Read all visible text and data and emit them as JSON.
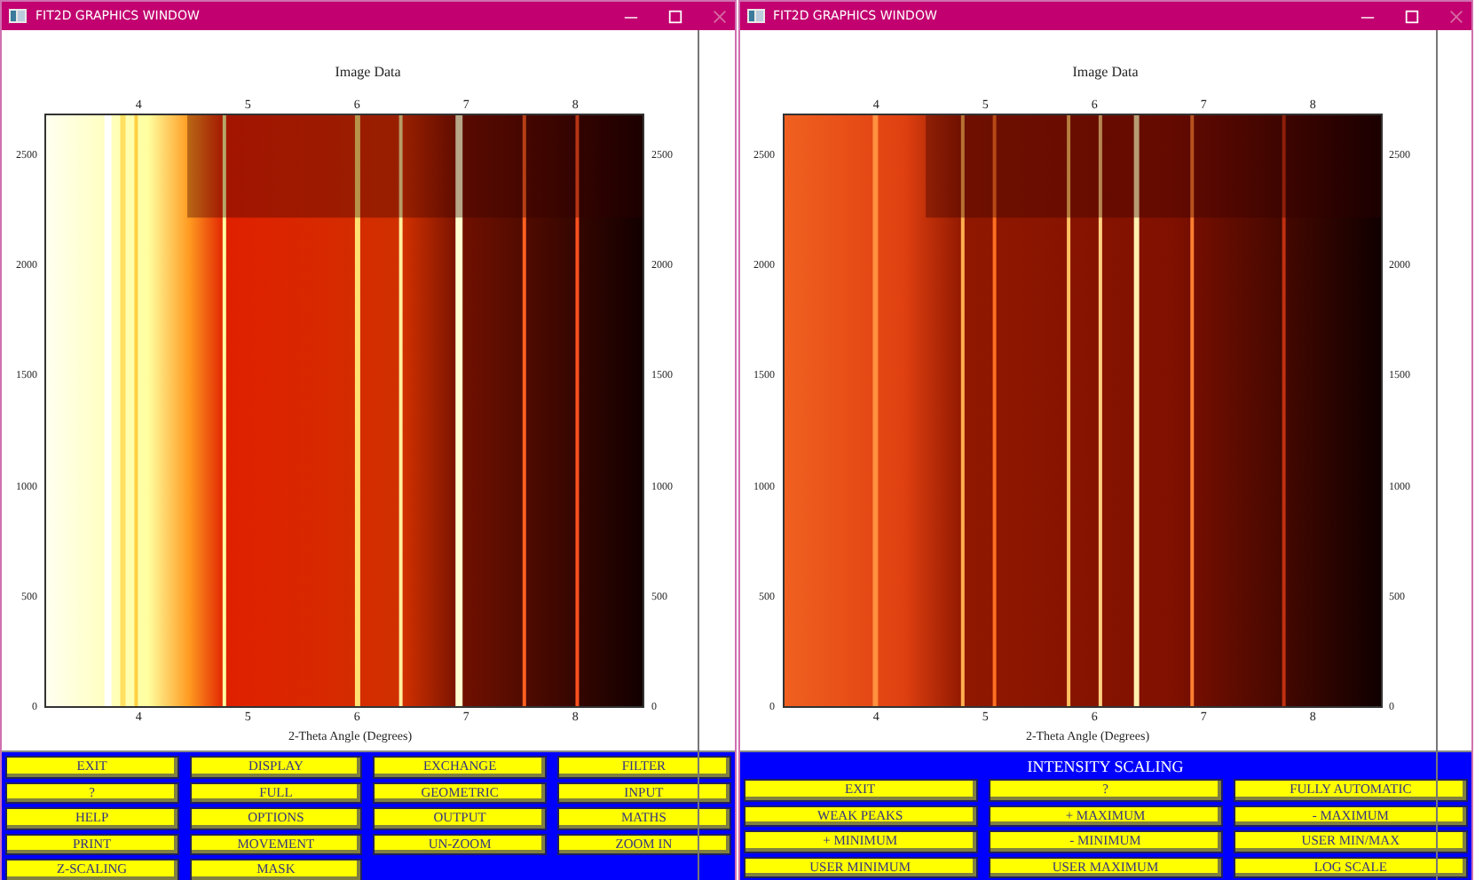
{
  "windows": [
    {
      "title": "FIT2D GRAPHICS WINDOW",
      "plot": {
        "title": "Image Data",
        "xlabel": "2-Theta Angle (Degrees)",
        "top_ticks": [
          "4",
          "5",
          "6",
          "7",
          "8"
        ],
        "bottom_ticks": [
          "4",
          "5",
          "6",
          "7",
          "8"
        ],
        "left_ticks": [
          "2500",
          "2000",
          "1500",
          "1000",
          "500",
          "0"
        ],
        "right_ticks": [
          "2500",
          "2000",
          "1500",
          "1000",
          "500",
          "0"
        ]
      },
      "menu": {
        "kind": "main",
        "buttons": [
          "EXIT",
          "DISPLAY",
          "EXCHANGE",
          "FILTER",
          "?",
          "FULL",
          "GEOMETRIC",
          "INPUT",
          "HELP",
          "OPTIONS",
          "OUTPUT",
          "MATHS",
          "PRINT",
          "MOVEMENT",
          "UN-ZOOM",
          "ZOOM IN",
          "Z-SCALING",
          "MASK"
        ]
      }
    },
    {
      "title": "FIT2D GRAPHICS WINDOW",
      "plot": {
        "title": "Image Data",
        "xlabel": "2-Theta Angle (Degrees)",
        "top_ticks": [
          "4",
          "5",
          "6",
          "7",
          "8"
        ],
        "bottom_ticks": [
          "4",
          "5",
          "6",
          "7",
          "8"
        ],
        "left_ticks": [
          "2500",
          "2000",
          "1500",
          "1000",
          "500",
          "0"
        ],
        "right_ticks": [
          "2500",
          "2000",
          "1500",
          "1000",
          "500",
          "0"
        ]
      },
      "menu": {
        "kind": "scaling",
        "header": "INTENSITY SCALING",
        "buttons": [
          "EXIT",
          "?",
          "FULLY AUTOMATIC",
          "WEAK PEAKS",
          "+ MAXIMUM",
          "- MAXIMUM",
          "+ MINIMUM",
          "- MINIMUM",
          "USER MIN/MAX",
          "USER MINIMUM",
          "USER MAXIMUM",
          "LOG SCALE"
        ]
      }
    }
  ]
}
